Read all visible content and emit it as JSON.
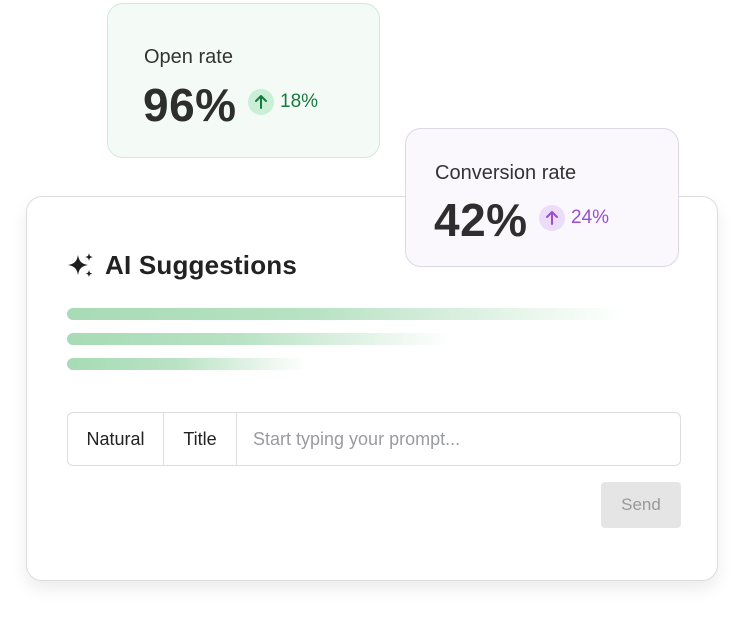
{
  "ai_panel": {
    "title": "AI Suggestions",
    "icon": "sparkle-icon",
    "suggestion_bars": [
      {
        "fill": 0.93
      },
      {
        "fill": 0.64
      },
      {
        "fill": 0.4
      }
    ],
    "modes": [
      "Natural",
      "Title"
    ],
    "prompt_placeholder": "Start typing your prompt...",
    "send_label": "Send"
  },
  "stats": {
    "open_rate": {
      "label": "Open rate",
      "value": "96%",
      "delta": "18%",
      "delta_icon": "arrow-up-icon",
      "accent": "#1a7a3e"
    },
    "conversion_rate": {
      "label": "Conversion rate",
      "value": "42%",
      "delta": "24%",
      "delta_icon": "arrow-up-icon",
      "accent": "#9b4fd0"
    }
  },
  "colors": {
    "bar_green": "#a7dbb5",
    "open_badge_bg": "#c9efd6",
    "conv_badge_bg": "#ecdcf8"
  }
}
